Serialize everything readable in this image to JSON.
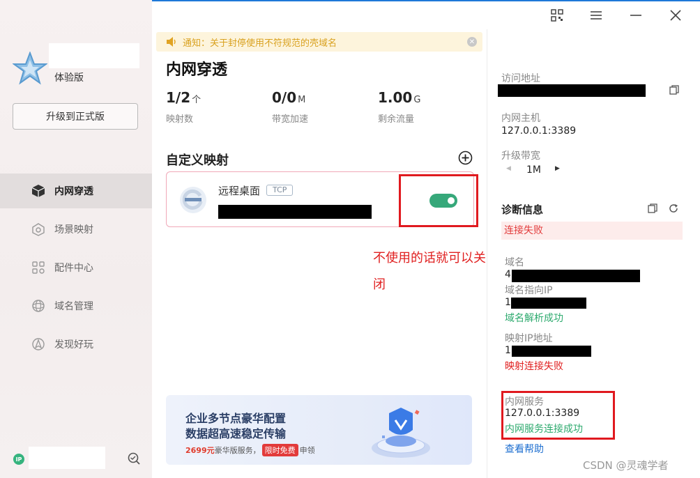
{
  "sidebar": {
    "edition": "体验版",
    "upgrade_label": "升级到正式版",
    "items": [
      {
        "label": "内网穿透",
        "icon": "cube-icon",
        "active": true
      },
      {
        "label": "场景映射",
        "icon": "scene-icon",
        "active": false
      },
      {
        "label": "配件中心",
        "icon": "grid-icon",
        "active": false
      },
      {
        "label": "域名管理",
        "icon": "globe-icon",
        "active": false
      },
      {
        "label": "发现好玩",
        "icon": "discover-icon",
        "active": false
      }
    ],
    "ip_badge": "IP"
  },
  "notice": {
    "text": "通知：关于封停使用不符规范的壳域名"
  },
  "main": {
    "title": "内网穿透",
    "stats": [
      {
        "value": "1/2",
        "unit": "个",
        "label": "映射数"
      },
      {
        "value": "0/0",
        "unit": "M",
        "label": "带宽加速"
      },
      {
        "value": "1.00",
        "unit": "G",
        "label": "剩余流量"
      }
    ],
    "section_title": "自定义映射",
    "mapping": {
      "name": "远程桌面",
      "protocol": "TCP",
      "enabled": true
    }
  },
  "annotation": {
    "text": "不使用的话就可以关闭"
  },
  "banner": {
    "line1": "企业多节点豪华配置",
    "line2": "数据超高速稳定传输",
    "price": "2699元",
    "desc": "豪华版服务，",
    "free": "限时免费",
    "suffix": "申领"
  },
  "right": {
    "access_label": "访问地址",
    "host_label": "内网主机",
    "host_value": "127.0.0.1:3389",
    "bandwidth_label": "升级带宽",
    "bandwidth_value": "1M",
    "diag_title": "诊断信息",
    "diag_status": "连接失败",
    "domain_label": "域名",
    "domain_prefix": "4",
    "domain_ip_label": "域名指向IP",
    "domain_ip_prefix": "1",
    "domain_resolve": "域名解析成功",
    "map_ip_label": "映射IP地址",
    "map_ip_prefix": "1",
    "map_conn": "映射连接失败",
    "service_label": "内网服务",
    "service_value": "127.0.0.1:3389",
    "service_status": "内网服务连接成功",
    "help": "查看帮助"
  },
  "watermark": "CSDN @灵魂学者",
  "colors": {
    "accent": "#36a87a",
    "error": "#e02020",
    "link": "#1e6fd0",
    "notice": "#d9a11f"
  }
}
